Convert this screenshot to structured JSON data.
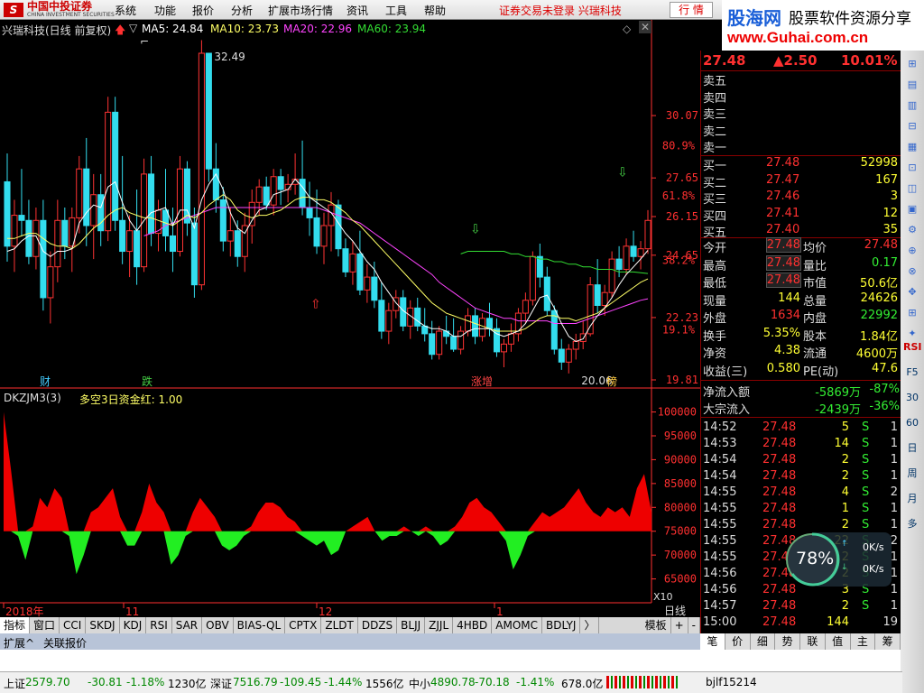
{
  "app": {
    "brand": "中国中投证券",
    "brand_en": "CHINA INVESTMENT SECURITIES",
    "menus": [
      "系统",
      "功能",
      "报价",
      "分析",
      "扩展市场行情",
      "资讯",
      "工具",
      "帮助"
    ],
    "notice": "证券交易未登录  兴瑞科技",
    "hq_button": "行 情"
  },
  "ad": {
    "line1": "股海网",
    "line1b": "股票软件资源分享",
    "line2": "www.Guhai.com.cn"
  },
  "chart_header": {
    "stock": "兴瑞科技(日线 前复权)",
    "ma5": "MA5: 24.84",
    "ma10": "MA10: 23.73",
    "ma20": "MA20: 22.96",
    "ma60": "MA60: 23.94"
  },
  "indicator_header": {
    "name": "DKZJM3(3)",
    "series": "多空3日资金红: 1.00"
  },
  "colors": {
    "up": "#ff3333",
    "down": "#33ddee",
    "ma5": "#ffffff",
    "ma10": "#ffff66",
    "ma20": "#ff44ff",
    "ma60": "#33dd33",
    "axis": "#ff3030"
  },
  "chart_data": [
    {
      "type": "candlestick",
      "title": "兴瑞科技(日线 前复权)",
      "y_ticks": [
        "30.07",
        "27.65",
        "26.15",
        "24.65",
        "22.23",
        "19.81"
      ],
      "y_pct_ticks": [
        "80.9%",
        "61.8%",
        "38.2%",
        "19.1%"
      ],
      "x_ticks": [
        "2018年",
        "11",
        "12",
        "1"
      ],
      "high_label": "32.49",
      "low_label": "20.06",
      "markers": [
        "财",
        "跌",
        "涨增",
        "榜"
      ],
      "ylim": [
        19.81,
        32.49
      ],
      "candles": [
        [
          27.5,
          28.6,
          24.4,
          25
        ],
        [
          25,
          26.8,
          24,
          26.2
        ],
        [
          26.2,
          28,
          25.4,
          26
        ],
        [
          26,
          26.8,
          24.3,
          24.6
        ],
        [
          24.6,
          26.5,
          24.1,
          26
        ],
        [
          26,
          26.8,
          22.5,
          23
        ],
        [
          23,
          24.8,
          22,
          24.2
        ],
        [
          24.2,
          26.8,
          23.6,
          26
        ],
        [
          26,
          26.5,
          24.5,
          25
        ],
        [
          25,
          26.5,
          24,
          26.1
        ],
        [
          26.1,
          28.5,
          25.5,
          28
        ],
        [
          28,
          29.2,
          25,
          25.8
        ],
        [
          25.8,
          27.8,
          24.5,
          27
        ],
        [
          27,
          27.8,
          25,
          25.6
        ],
        [
          25.6,
          30.8,
          25.2,
          30.2
        ],
        [
          30.2,
          30.8,
          25.6,
          26
        ],
        [
          26,
          28.5,
          24.3,
          24.8
        ],
        [
          24.8,
          26.2,
          23.8,
          25.6
        ],
        [
          25.6,
          27.2,
          23.5,
          24.2
        ],
        [
          24.2,
          28.4,
          24,
          27.8
        ],
        [
          27.8,
          28.5,
          25,
          25.5
        ],
        [
          25.5,
          26.8,
          24.8,
          26.4
        ],
        [
          26.4,
          28,
          24.8,
          25.4
        ],
        [
          25.4,
          26.5,
          24,
          24.8
        ],
        [
          24.8,
          28.5,
          24.6,
          28
        ],
        [
          28,
          28.3,
          25.4,
          25.9
        ],
        [
          25.9,
          26.5,
          23,
          23.5
        ],
        [
          23.5,
          33,
          23.3,
          32.49
        ],
        [
          32.49,
          32.49,
          27.5,
          28
        ],
        [
          28,
          29,
          26.3,
          26.8
        ],
        [
          26.8,
          27.3,
          24.8,
          25.2
        ],
        [
          25.2,
          26.5,
          24.6,
          25.6
        ],
        [
          25.6,
          26,
          24.2,
          24.6
        ],
        [
          24.6,
          26.3,
          24,
          25.8
        ],
        [
          25.8,
          27.2,
          25.1,
          26.7
        ],
        [
          26.7,
          27.6,
          26.2,
          27.3
        ],
        [
          27.3,
          27.7,
          26.4,
          26.6
        ],
        [
          26.6,
          28,
          26.2,
          27.7
        ],
        [
          27.7,
          28,
          26.6,
          27.2
        ],
        [
          27.2,
          27.8,
          26.7,
          27.4
        ],
        [
          27.4,
          28.6,
          27,
          27.6
        ],
        [
          27.6,
          29.1,
          26.2,
          26.5
        ],
        [
          26.5,
          27.5,
          25.4,
          26.1
        ],
        [
          26.1,
          27.2,
          24.7,
          25
        ],
        [
          25,
          26.3,
          24.3,
          25.8
        ],
        [
          25.8,
          27.1,
          24.8,
          26.6
        ],
        [
          26.6,
          26.8,
          24.6,
          24.9
        ],
        [
          24.9,
          25.3,
          23.8,
          24
        ],
        [
          24,
          25.2,
          23.5,
          24.7
        ],
        [
          24.7,
          25.6,
          23.1,
          23.3
        ],
        [
          23.3,
          24.3,
          22.8,
          23.8
        ],
        [
          23.8,
          24.4,
          22.6,
          22.9
        ],
        [
          22.9,
          23.6,
          21.4,
          21.7
        ],
        [
          21.7,
          22.8,
          21.2,
          22.5
        ],
        [
          22.5,
          23.3,
          22.2,
          23
        ],
        [
          23,
          23.3,
          21.7,
          21.9
        ],
        [
          21.9,
          22.9,
          21.4,
          22.6
        ],
        [
          22.6,
          23,
          21.7,
          21.9
        ],
        [
          21.9,
          22.6,
          21.3,
          21.6
        ],
        [
          21.6,
          22.1,
          20.6,
          20.8
        ],
        [
          20.8,
          21.9,
          20.6,
          21.7
        ],
        [
          21.7,
          22.3,
          21.2,
          21.5
        ],
        [
          21.5,
          22.2,
          20.9,
          21
        ],
        [
          21,
          21.9,
          20.8,
          21.7
        ],
        [
          21.7,
          22.6,
          21.5,
          22.3
        ],
        [
          22.3,
          22.6,
          21.2,
          21.5
        ],
        [
          21.5,
          22.4,
          21.3,
          22.2
        ],
        [
          22.2,
          22.8,
          21.5,
          21.8
        ],
        [
          21.8,
          22.2,
          20.7,
          20.9
        ],
        [
          20.9,
          21.4,
          20.3,
          21.2
        ],
        [
          21.2,
          22,
          20.9,
          21.6
        ],
        [
          21.6,
          22.6,
          21.3,
          22.4
        ],
        [
          22.4,
          23.2,
          22,
          22.9
        ],
        [
          22.9,
          24.8,
          22.7,
          24.6
        ],
        [
          24.6,
          25.1,
          23.4,
          23.8
        ],
        [
          23.8,
          24.2,
          22.3,
          22.5
        ],
        [
          22.5,
          22.7,
          20.8,
          21
        ],
        [
          21,
          21.4,
          20.2,
          20.5
        ],
        [
          20.5,
          21.2,
          20.06,
          21
        ],
        [
          21,
          21.6,
          20.6,
          21.3
        ],
        [
          21.3,
          22.1,
          21,
          21.6
        ],
        [
          21.6,
          23.8,
          21.5,
          23.5
        ],
        [
          23.5,
          24.5,
          22.4,
          22.7
        ],
        [
          22.7,
          23.5,
          22.3,
          23.2
        ],
        [
          23.2,
          24.8,
          23,
          24.5
        ],
        [
          24.5,
          25,
          23.8,
          24.1
        ],
        [
          24.1,
          25.3,
          23.9,
          25
        ],
        [
          25,
          25.6,
          24.4,
          24.6
        ],
        [
          24.6,
          25.2,
          24.1,
          24.9
        ],
        [
          24.9,
          26.4,
          24.7,
          26
        ]
      ],
      "ma5": [
        24.8,
        24.9,
        25.2,
        25.4,
        25.4,
        24.8,
        24.6,
        24.8,
        24.8,
        24.9,
        25.9,
        26.3,
        26.6,
        26.5,
        27.3,
        27.5,
        26.7,
        26,
        25.6,
        26,
        26.3,
        26.4,
        26.5,
        25.8,
        26.4,
        26.4,
        25.7,
        26.8,
        27.4,
        27.8,
        27.2,
        26.3,
        25.7,
        25.5,
        26,
        26.4,
        26.5,
        27,
        27.1,
        27.2,
        27.6,
        27.3,
        26.9,
        26.7,
        26.5,
        26.3,
        25.9,
        25.5,
        25.2,
        24.8,
        24.4,
        24.1,
        23.6,
        23.2,
        22.8,
        22.5,
        22.3,
        22.1,
        21.9,
        21.8,
        21.8,
        21.7,
        21.5,
        21.5,
        21.7,
        21.8,
        21.8,
        21.8,
        21.6,
        21.5,
        21.6,
        21.7,
        22,
        22.5,
        23,
        23.1,
        22.6,
        22,
        21.5,
        21.3,
        21.4,
        21.9,
        22.3,
        22.6,
        23,
        23.5,
        23.9,
        24.2,
        24.5,
        24.84
      ],
      "ma10": [
        25.3,
        25.3,
        25.4,
        25.5,
        25.5,
        25.3,
        25.1,
        25,
        25,
        24.9,
        25.1,
        25.4,
        25.7,
        25.9,
        26.2,
        26.4,
        26.5,
        26.3,
        26.2,
        26.1,
        26.1,
        26,
        25.9,
        25.8,
        26,
        26.2,
        26.1,
        26.3,
        26.6,
        26.8,
        27,
        26.8,
        26.4,
        26.2,
        26.1,
        26.2,
        26.2,
        26.3,
        26.4,
        26.6,
        26.8,
        26.9,
        26.9,
        26.8,
        26.8,
        26.7,
        26.5,
        26.3,
        26,
        25.8,
        25.5,
        25.2,
        24.9,
        24.6,
        24.3,
        24,
        23.7,
        23.4,
        23.1,
        22.8,
        22.6,
        22.4,
        22.3,
        22.2,
        22.1,
        22,
        21.9,
        21.8,
        21.7,
        21.7,
        21.7,
        21.7,
        21.8,
        22,
        22.2,
        22.3,
        22.3,
        22.2,
        22.2,
        22.1,
        22.2,
        22.3,
        22.4,
        22.6,
        22.8,
        23,
        23.2,
        23.4,
        23.6,
        23.73
      ],
      "ma20": [
        null,
        null,
        null,
        null,
        null,
        null,
        null,
        null,
        null,
        null,
        null,
        null,
        null,
        null,
        null,
        null,
        null,
        null,
        null,
        25.4,
        25.5,
        25.6,
        25.8,
        25.9,
        26,
        26.1,
        26.2,
        26.3,
        26.4,
        26.5,
        26.5,
        26.5,
        26.5,
        26.5,
        26.5,
        26.5,
        26.5,
        26.5,
        26.5,
        26.5,
        26.5,
        26.5,
        26.5,
        26.5,
        26.4,
        26.3,
        26.2,
        26.1,
        26,
        25.9,
        25.7,
        25.5,
        25.3,
        25.1,
        24.9,
        24.7,
        24.5,
        24.3,
        24.1,
        23.9,
        23.6,
        23.4,
        23.2,
        23,
        22.8,
        22.6,
        22.5,
        22.4,
        22.3,
        22.2,
        22.2,
        22.1,
        22.1,
        22.1,
        22.1,
        22.1,
        22,
        22,
        22,
        22,
        22.1,
        22.2,
        22.3,
        22.4,
        22.5,
        22.6,
        22.7,
        22.8,
        22.9,
        22.96
      ],
      "ma60": [
        null,
        null,
        null,
        null,
        null,
        null,
        null,
        null,
        null,
        null,
        null,
        null,
        null,
        null,
        null,
        null,
        null,
        null,
        null,
        null,
        null,
        null,
        null,
        null,
        null,
        null,
        null,
        null,
        null,
        null,
        null,
        null,
        null,
        null,
        null,
        null,
        null,
        null,
        null,
        null,
        null,
        null,
        null,
        null,
        null,
        null,
        null,
        null,
        null,
        null,
        null,
        null,
        null,
        null,
        null,
        null,
        null,
        null,
        null,
        null,
        null,
        null,
        null,
        24.7,
        24.8,
        24.8,
        24.8,
        24.8,
        24.8,
        24.8,
        24.7,
        24.7,
        24.6,
        24.6,
        24.5,
        24.5,
        24.4,
        24.4,
        24.3,
        24.3,
        24.2,
        24.2,
        24.1,
        24.1,
        24.1,
        24,
        24,
        24,
        23.97,
        23.94
      ]
    },
    {
      "type": "bar",
      "title": "DKZJM3(3)",
      "series": [
        {
          "name": "多空3日资金红",
          "values": [
            100000,
            88000,
            74000,
            69000,
            76000,
            82000,
            80000,
            84000,
            82000,
            74000,
            66000,
            70000,
            79000,
            80000,
            82000,
            84000,
            78000,
            72000,
            72000,
            79000,
            85000,
            81000,
            79000,
            68000,
            70000,
            74000,
            79000,
            82000,
            80000,
            78000,
            72000,
            71000,
            72000,
            74000,
            76000,
            79000,
            81000,
            81000,
            80000,
            78000,
            77000,
            74000,
            73000,
            72000,
            73000,
            70000,
            71000,
            75000,
            76000,
            77000,
            78000,
            75000,
            73000,
            74000,
            74000,
            76000,
            75000,
            74000,
            76000,
            74000,
            72000,
            73000,
            76000,
            78000,
            81000,
            82000,
            80000,
            79000,
            77000,
            73000,
            67000,
            70000,
            74000,
            77000,
            79000,
            78000,
            79000,
            80000,
            82000,
            84000,
            81000,
            79000,
            78000,
            80000,
            79000,
            80000,
            78000,
            84000,
            87000,
            79000
          ]
        }
      ],
      "y_ticks": [
        "100000",
        "95000",
        "90000",
        "85000",
        "80000",
        "75000",
        "70000",
        "65000"
      ],
      "baseline": 75000,
      "ylim": [
        60000,
        102000
      ],
      "x_label": "X10"
    }
  ],
  "quote": {
    "price": "27.48",
    "change": "▲2.50",
    "pct": "10.01%"
  },
  "sell": [
    {
      "label": "卖五"
    },
    {
      "label": "卖四"
    },
    {
      "label": "卖三"
    },
    {
      "label": "卖二"
    },
    {
      "label": "卖一"
    }
  ],
  "buy": [
    {
      "label": "买一",
      "p": "27.48",
      "v": "52998"
    },
    {
      "label": "买二",
      "p": "27.47",
      "v": "167"
    },
    {
      "label": "买三",
      "p": "27.46",
      "v": "3"
    },
    {
      "label": "买四",
      "p": "27.41",
      "v": "12"
    },
    {
      "label": "买五",
      "p": "27.40",
      "v": "35"
    }
  ],
  "stats": [
    [
      "今开",
      "27.48",
      "均价",
      "27.48"
    ],
    [
      "最高",
      "27.48",
      "量比",
      "0.17"
    ],
    [
      "最低",
      "27.48",
      "市值",
      "50.6亿"
    ],
    [
      "现量",
      "144",
      "总量",
      "24626"
    ],
    [
      "外盘",
      "1634",
      "内盘",
      "22992"
    ],
    [
      "换手",
      "5.35%",
      "股本",
      "1.84亿"
    ],
    [
      "净资",
      "4.38",
      "流通",
      "4600万"
    ],
    [
      "收益(三)",
      "0.580",
      "PE(动)",
      "47.6"
    ]
  ],
  "flows": [
    [
      "净流入额",
      "-5869万",
      "-87%"
    ],
    [
      "大宗流入",
      "-2439万",
      "-36%"
    ]
  ],
  "ticks": [
    [
      "14:52",
      "27.48",
      "5",
      "S",
      "1"
    ],
    [
      "14:53",
      "27.48",
      "14",
      "S",
      "1"
    ],
    [
      "14:54",
      "27.48",
      "2",
      "S",
      "1"
    ],
    [
      "14:54",
      "27.48",
      "2",
      "S",
      "1"
    ],
    [
      "14:55",
      "27.48",
      "4",
      "S",
      "2"
    ],
    [
      "14:55",
      "27.48",
      "1",
      "S",
      "1"
    ],
    [
      "14:55",
      "27.48",
      "2",
      "S",
      "1"
    ],
    [
      "14:55",
      "27.48",
      "22",
      "S",
      "2"
    ],
    [
      "14:55",
      "27.48",
      "2",
      "S",
      "1"
    ],
    [
      "14:56",
      "27.48",
      "2",
      "S",
      "1"
    ],
    [
      "14:56",
      "27.48",
      "3",
      "S",
      "1"
    ],
    [
      "14:57",
      "27.48",
      "2",
      "S",
      "1"
    ],
    [
      "15:00",
      "27.48",
      "144",
      "",
      "19"
    ]
  ],
  "right_tabs": [
    "笔",
    "价",
    "细",
    "势",
    "联",
    "值",
    "主",
    "筹"
  ],
  "side_icons": [
    "RSI",
    "F5",
    "30",
    "60",
    "日",
    "周",
    "月",
    "多"
  ],
  "indicator_tabs": [
    "指标",
    "窗口",
    "CCI",
    "SKDJ",
    "KDJ",
    "RSI",
    "SAR",
    "OBV",
    "BIAS-QL",
    "CPTX",
    "ZLDT",
    "DDZS",
    "BLJJ",
    "ZJJL",
    "4HBD",
    "AMOMC",
    "BDLYJ",
    "〉",
    "模板",
    "+",
    "-"
  ],
  "ext_tabs": [
    "扩展^",
    "关联报价"
  ],
  "period_label": "日线",
  "widget": {
    "pct": "78%",
    "up": "0K/s",
    "down": "0K/s"
  },
  "status": {
    "sh_name": "上证",
    "sh": "2579.70",
    "sh_chg": "-30.81",
    "sh_pct": "-1.18%",
    "sh_amt": "1230亿",
    "sz_name": "深证",
    "sz": "7516.79",
    "sz_chg": "-109.45",
    "sz_pct": "-1.44%",
    "sz_amt": "1556亿",
    "zx_name": "中小",
    "zx": "4890.78",
    "zx_chg": "-70.18",
    "zx_pct": "-1.41%",
    "zx_amt": "678.0亿",
    "code": "bjlf15214"
  }
}
